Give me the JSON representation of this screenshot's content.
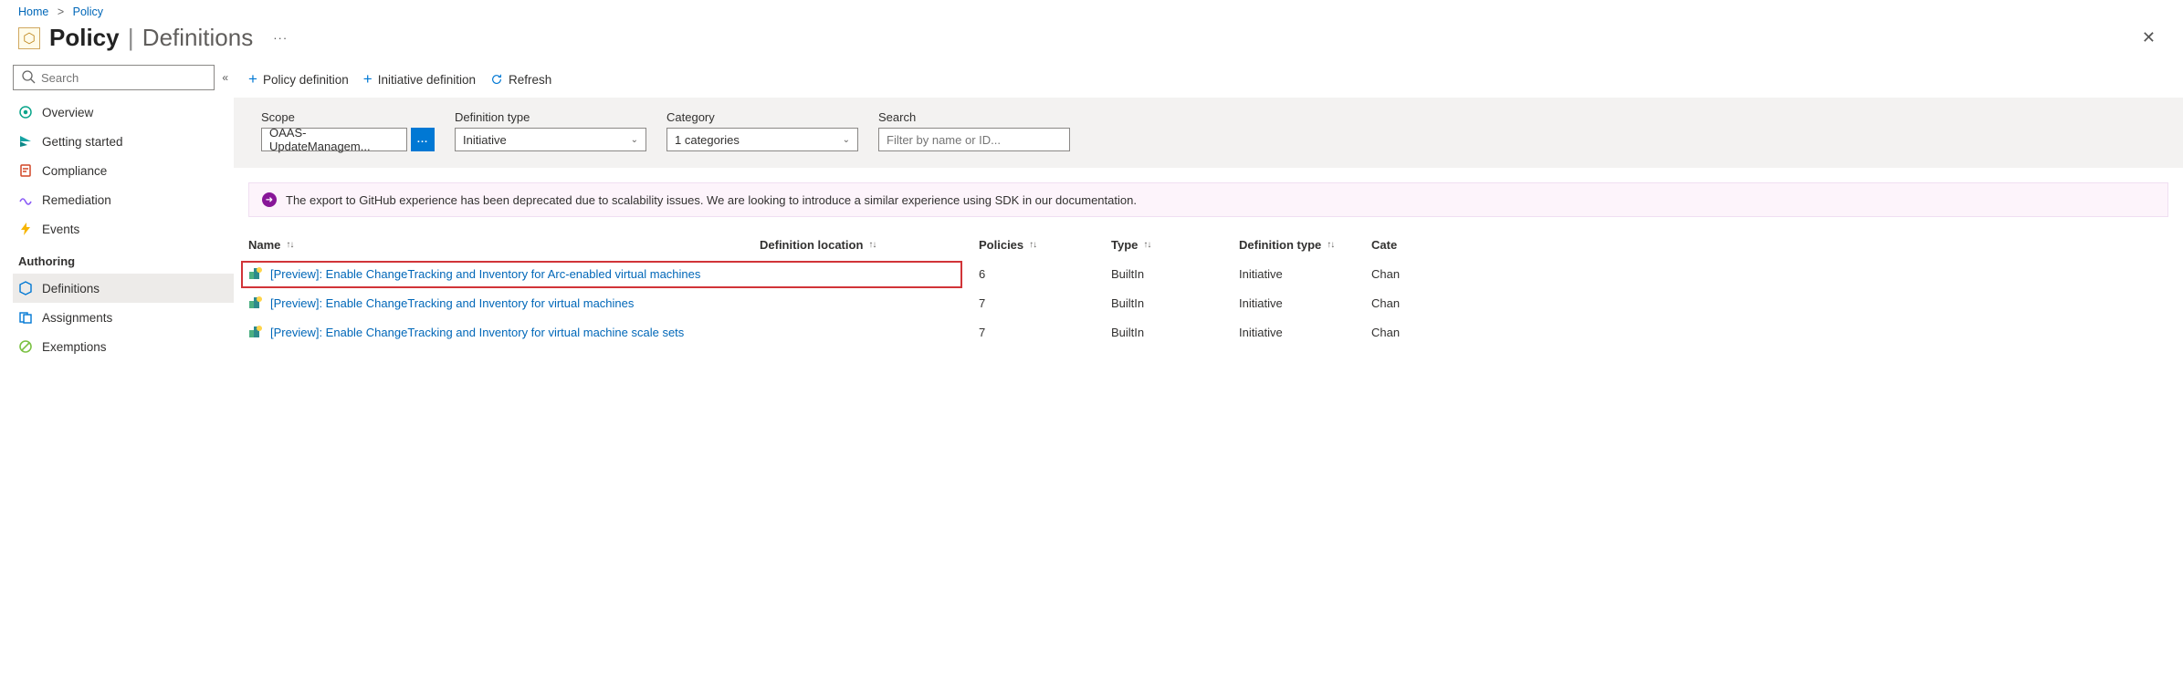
{
  "breadcrumb": {
    "home": "Home",
    "policy": "Policy"
  },
  "header": {
    "title": "Policy",
    "subtitle": "Definitions"
  },
  "sidebar": {
    "search_placeholder": "Search",
    "items": [
      {
        "label": "Overview"
      },
      {
        "label": "Getting started"
      },
      {
        "label": "Compliance"
      },
      {
        "label": "Remediation"
      },
      {
        "label": "Events"
      }
    ],
    "section": "Authoring",
    "auth_items": [
      {
        "label": "Definitions"
      },
      {
        "label": "Assignments"
      },
      {
        "label": "Exemptions"
      }
    ]
  },
  "toolbar": {
    "policy_def": "Policy definition",
    "initiative_def": "Initiative definition",
    "refresh": "Refresh"
  },
  "filters": {
    "scope_label": "Scope",
    "scope_value": "OAAS-UpdateManagem...",
    "deftype_label": "Definition type",
    "deftype_value": "Initiative",
    "category_label": "Category",
    "category_value": "1 categories",
    "search_label": "Search",
    "search_placeholder": "Filter by name or ID..."
  },
  "banner": {
    "text": "The export to GitHub experience has been deprecated due to scalability issues. We are looking to introduce a similar experience using SDK in our documentation."
  },
  "table": {
    "columns": {
      "name": "Name",
      "loc": "Definition location",
      "policies": "Policies",
      "type": "Type",
      "deftype": "Definition type",
      "cat": "Cate"
    },
    "rows": [
      {
        "name": "[Preview]: Enable ChangeTracking and Inventory for Arc-enabled virtual machines",
        "loc": "",
        "policies": "6",
        "type": "BuiltIn",
        "deftype": "Initiative",
        "cat": "Chan",
        "highlight": true
      },
      {
        "name": "[Preview]: Enable ChangeTracking and Inventory for virtual machines",
        "loc": "",
        "policies": "7",
        "type": "BuiltIn",
        "deftype": "Initiative",
        "cat": "Chan",
        "highlight": false
      },
      {
        "name": "[Preview]: Enable ChangeTracking and Inventory for virtual machine scale sets",
        "loc": "",
        "policies": "7",
        "type": "BuiltIn",
        "deftype": "Initiative",
        "cat": "Chan",
        "highlight": false
      }
    ]
  }
}
